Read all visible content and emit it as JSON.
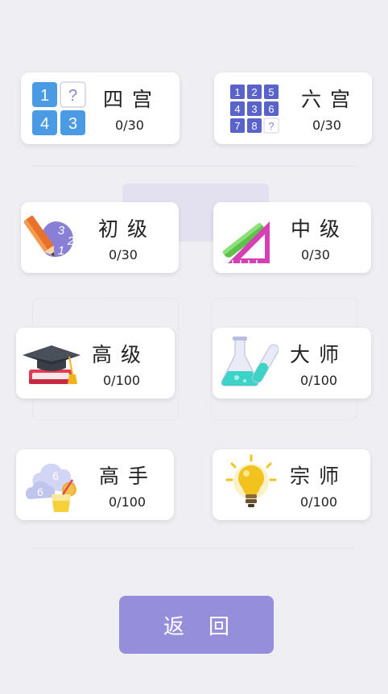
{
  "levels": [
    {
      "name": "四宫",
      "progress": "0/30",
      "icon": "grid-4-icon"
    },
    {
      "name": "六宫",
      "progress": "0/30",
      "icon": "grid-6-icon"
    },
    {
      "name": "初级",
      "progress": "0/30",
      "icon": "pencil-numbers-icon"
    },
    {
      "name": "中级",
      "progress": "0/30",
      "icon": "ruler-triangle-icon"
    },
    {
      "name": "高级",
      "progress": "0/100",
      "icon": "graduation-cap-icon"
    },
    {
      "name": "大师",
      "progress": "0/100",
      "icon": "flask-icon"
    },
    {
      "name": "高手",
      "progress": "0/100",
      "icon": "cloud-juice-icon"
    },
    {
      "name": "宗师",
      "progress": "0/100",
      "icon": "lightbulb-icon"
    }
  ],
  "icon_text": {
    "grid4": [
      "1",
      "?",
      "4",
      "3"
    ],
    "grid6": [
      "1",
      "2",
      "5",
      "4",
      "3",
      "6",
      "7",
      "8",
      "?"
    ],
    "pencil": [
      "3",
      "2",
      "1"
    ],
    "cloud": [
      "6",
      "6"
    ]
  },
  "back_label": "返回",
  "colors": {
    "accent": "#958fdb",
    "tile_blue": "#4a9be3",
    "tile_indigo": "#5a63c9",
    "question_mark": "#8a7fd6"
  }
}
